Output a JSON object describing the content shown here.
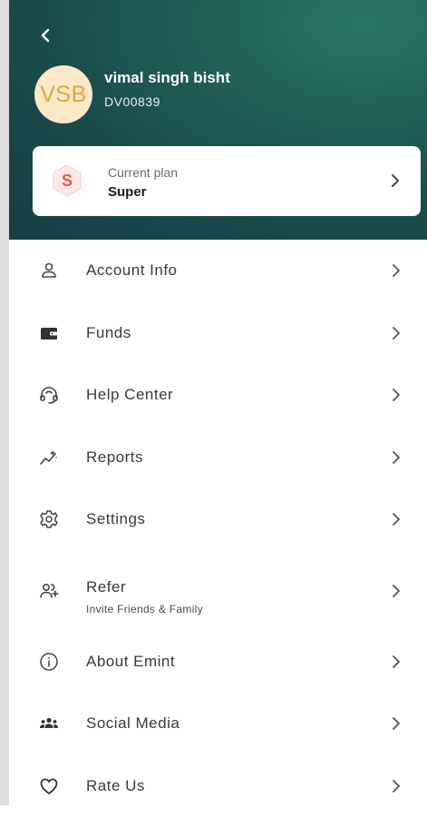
{
  "profile": {
    "avatar_initials": "VSB",
    "name": "vimal singh bisht",
    "client_id": "DV00839"
  },
  "plan": {
    "caption": "Current plan",
    "name": "Super",
    "badge_letter": "S"
  },
  "menu": {
    "items": [
      {
        "label": "Account Info",
        "icon": "user-icon"
      },
      {
        "label": "Funds",
        "icon": "wallet-icon"
      },
      {
        "label": "Help Center",
        "icon": "headset-icon"
      },
      {
        "label": "Reports",
        "icon": "chart-trend-icon"
      },
      {
        "label": "Settings",
        "icon": "gear-icon"
      },
      {
        "label": "Refer",
        "sublabel": "Invite Friends & Family",
        "icon": "user-add-icon"
      },
      {
        "label": "About Emint",
        "icon": "info-icon"
      },
      {
        "label": "Social Media",
        "icon": "group-icon"
      },
      {
        "label": "Rate Us",
        "icon": "heart-icon"
      }
    ]
  },
  "colors": {
    "header_dark": "#163e44",
    "header_light": "#2a7565",
    "avatar_bg": "#fae8c8",
    "avatar_text": "#e0a83c",
    "badge_accent": "#e2574c"
  }
}
